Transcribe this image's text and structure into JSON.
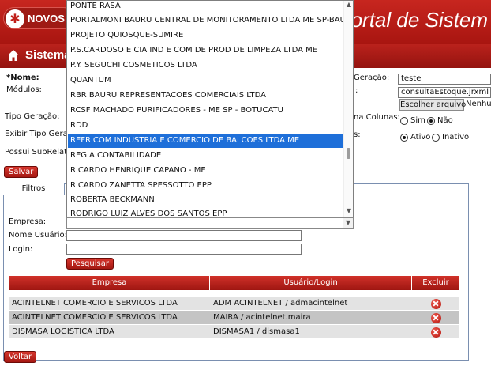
{
  "header": {
    "logo_text": "NOVOS",
    "title": "ortal de Sistem"
  },
  "subbar": {
    "title": "Sistema"
  },
  "form": {
    "nome_label": "*Nome:",
    "modulos_label": "Módulos:",
    "tipo_geracao_label": "Tipo Geração:",
    "exibir_tipo_label": "Exibir Tipo Gera",
    "possui_sub_label": "Possui SubRelato",
    "geracao_label": "Geração:",
    "geracao_value": "teste",
    "arquivo_label": ":",
    "arquivo_value": "consultaEstoque.jrxml",
    "escolher_button": "Escolher arquivo",
    "nenhum_text": "Nenhu",
    "coluna_label": "na Colunas:",
    "sim_label": "Sim",
    "nao_label": "Não",
    "status_label": "s:",
    "ativo_label": "Ativo",
    "inativo_label": "Inativo",
    "salvar_button": "Salvar"
  },
  "filtros": {
    "tab_label": "Filtros",
    "empresa_label": "Empresa:",
    "nome_usuario_label": "Nome Usuário:",
    "login_label": "Login:",
    "pesquisar_button": "Pesquisar"
  },
  "table": {
    "columns": [
      "Empresa",
      "Usuário/Login",
      "Excluir"
    ],
    "rows": [
      {
        "empresa": "ACINTELNET COMERCIO E SERVICOS LTDA",
        "usuario": "ADM ACINTELNET / admacintelnet"
      },
      {
        "empresa": "ACINTELNET COMERCIO E SERVICOS LTDA",
        "usuario": "MAIRA / acintelnet.maira"
      },
      {
        "empresa": "DISMASA LOGISTICA LTDA",
        "usuario": "DISMASA1 / dismasa1"
      }
    ]
  },
  "voltar_button": "Voltar",
  "dropdown": {
    "items": [
      "PONTE RASA",
      "PORTALMONI BAURU CENTRAL DE MONITORAMENTO LTDA ME SP-BAURU",
      "PROJETO QUIOSQUE-SUMIRE",
      "P.S.CARDOSO E CIA IND E COM DE PROD DE LIMPEZA LTDA ME",
      "P.Y. SEGUCHI COSMETICOS LTDA",
      "QUANTUM",
      "RBR BAURU REPRESENTACOES COMERCIAIS LTDA",
      "RCSF MACHADO PURIFICADORES - ME SP - BOTUCATU",
      "RDD",
      "REFRICOM INDUSTRIA E COMERCIO DE BALCOES LTDA ME",
      "REGIA CONTABILIDADE",
      "RICARDO HENRIQUE CAPANO - ME",
      "RICARDO ZANETTA SPESSOTTO EPP",
      "ROBERTA BECKMANN",
      "RODRIGO LUIZ ALVES DOS SANTOS EPP"
    ],
    "selected_index": 9
  },
  "colors": {
    "brand_red": "#c0201a",
    "selection_blue": "#1e6fd9",
    "row_alt": "#c4c4c4",
    "row": "#e3e3e3"
  }
}
